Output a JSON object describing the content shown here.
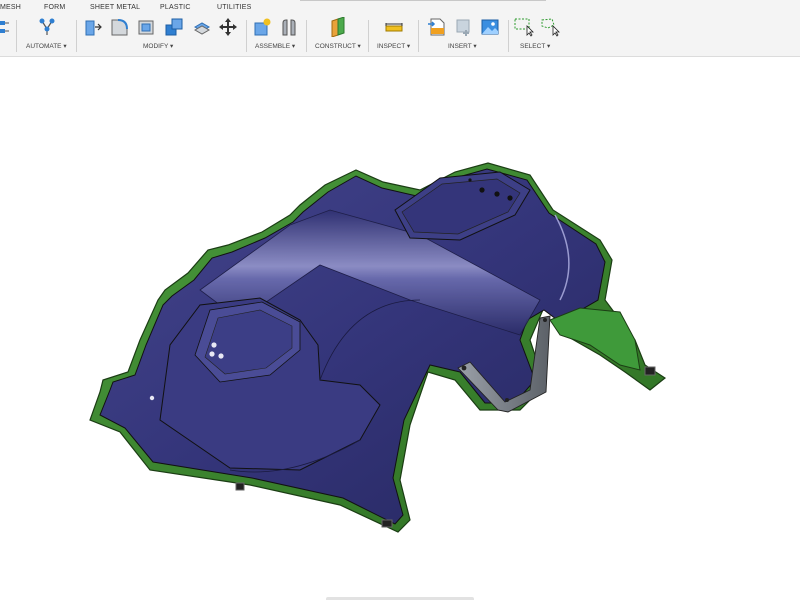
{
  "tabs": [
    {
      "label": "MESH"
    },
    {
      "label": "FORM"
    },
    {
      "label": "SHEET METAL"
    },
    {
      "label": "PLASTIC"
    },
    {
      "label": "UTILITIES"
    }
  ],
  "groups": {
    "automate": "AUTOMATE ▾",
    "modify": "MODIFY ▾",
    "assemble": "ASSEMBLE ▾",
    "construct": "CONSTRUCT ▾",
    "inspect": "INSPECT ▾",
    "insert": "INSERT ▾",
    "select": "SELECT ▾"
  },
  "icons": {
    "automate": [
      "node-graph-icon"
    ],
    "modify": [
      "press-pull-icon",
      "fillet-icon",
      "shell-icon",
      "combine-icon",
      "offset-face-icon",
      "move-icon"
    ],
    "assemble": [
      "new-component-icon",
      "joint-icon"
    ],
    "construct": [
      "offset-plane-icon"
    ],
    "inspect": [
      "measure-icon"
    ],
    "insert": [
      "insert-svg-icon",
      "insert-decal-icon",
      "insert-canvas-icon"
    ],
    "select": [
      "window-select-icon",
      "freeform-select-icon"
    ]
  },
  "colors": {
    "part_body": "#34357a",
    "part_edge": "#2d6e22",
    "toolbar_bg": "#f4f4f4"
  }
}
